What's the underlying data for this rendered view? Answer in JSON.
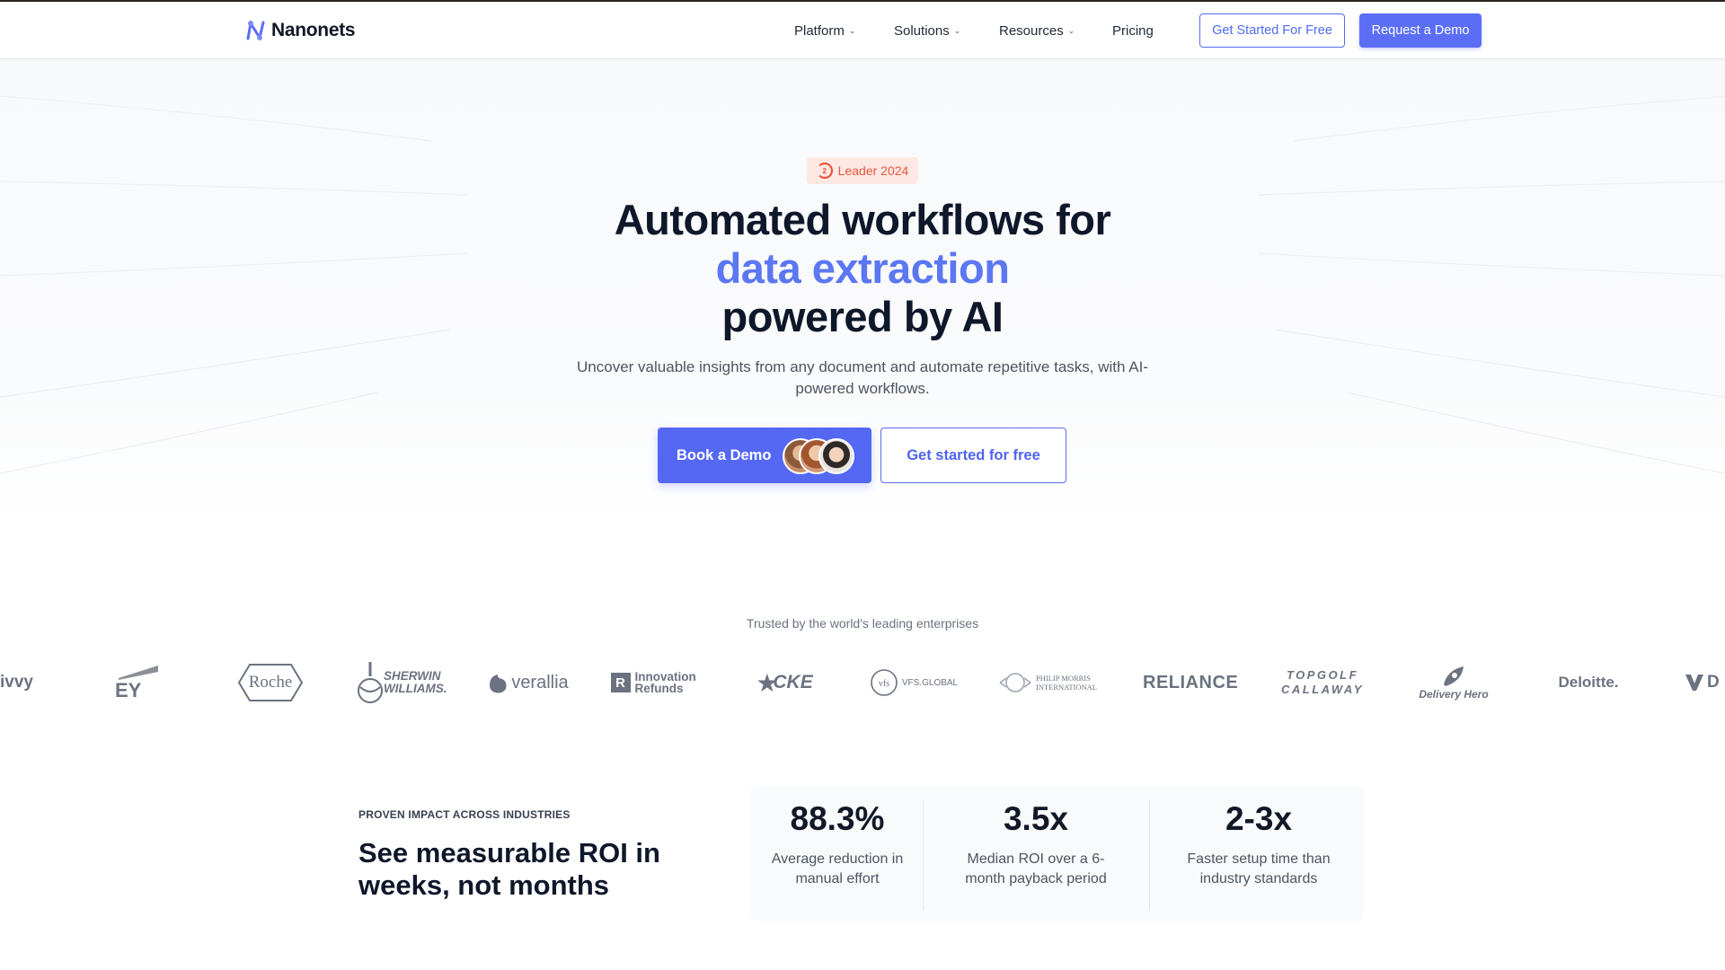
{
  "nav": {
    "brand": "Nanonets",
    "menu": [
      {
        "label": "Platform",
        "has_dropdown": true
      },
      {
        "label": "Solutions",
        "has_dropdown": true
      },
      {
        "label": "Resources",
        "has_dropdown": true
      },
      {
        "label": "Pricing",
        "has_dropdown": false
      }
    ],
    "cta_free": "Get Started For Free",
    "cta_demo": "Request a Demo"
  },
  "hero": {
    "badge": "Leader 2024",
    "badge_icon": "g2-icon",
    "title_line1": "Automated workflows for",
    "title_line2": "data extraction",
    "title_line3": "powered by AI",
    "subtitle": "Uncover valuable insights from any document and automate repetitive tasks, with AI-powered workflows.",
    "book_demo": "Book a Demo",
    "get_started": "Get started for free"
  },
  "trusted": {
    "heading": "Trusted by the world's leading enterprises",
    "logos": [
      "ivvy",
      "EY",
      "Roche",
      "SHERWIN WILLIAMS.",
      "verallia",
      "Innovation Refunds",
      "CKE",
      "VFS.GLOBAL",
      "PHILIP MORRIS INTERNATIONAL",
      "RELIANCE",
      "TOPGOLF CALLAWAY",
      "Delivery Hero",
      "Deloitte.",
      "D"
    ]
  },
  "impact": {
    "eyebrow": "PROVEN IMPACT ACROSS INDUSTRIES",
    "title": "See measurable ROI in weeks, not months",
    "stats": [
      {
        "value": "88.3%",
        "label": "Average reduction in manual effort"
      },
      {
        "value": "3.5x",
        "label": "Median ROI over a 6-month payback period"
      },
      {
        "value": "2-3x",
        "label": "Faster setup time than industry standards"
      }
    ]
  },
  "colors": {
    "accent": "#5b6ef5",
    "accent_text": "#5b77f2",
    "badge_bg": "#fde8e4",
    "badge_text": "#e8573a"
  }
}
